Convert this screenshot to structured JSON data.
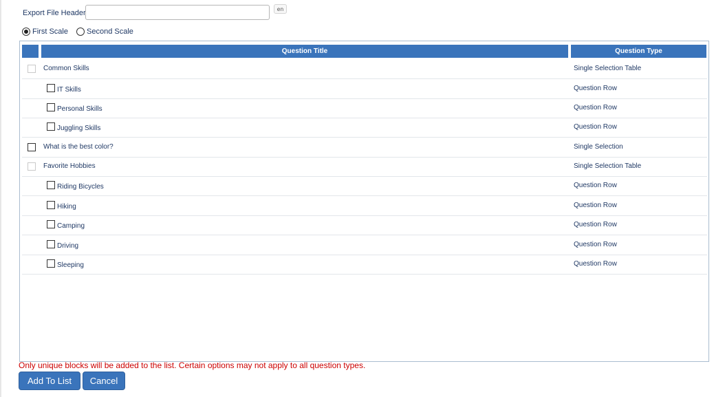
{
  "export_header": {
    "label": "Export File Header",
    "value": "",
    "placeholder": "",
    "lang": "en"
  },
  "scale": {
    "options": [
      {
        "label": "First Scale",
        "selected": true
      },
      {
        "label": "Second Scale",
        "selected": false
      }
    ]
  },
  "table": {
    "columns": [
      "Question Title",
      "Question Type"
    ],
    "rows": [
      {
        "title": "Common Skills",
        "type": "Single Selection Table",
        "level": 0,
        "disabled": true
      },
      {
        "title": "IT Skills",
        "type": "Question Row",
        "level": 1,
        "disabled": false
      },
      {
        "title": "Personal Skills",
        "type": "Question Row",
        "level": 1,
        "disabled": false
      },
      {
        "title": "Juggling Skills",
        "type": "Question Row",
        "level": 1,
        "disabled": false
      },
      {
        "title": "What is the best color?",
        "type": "Single Selection",
        "level": 0,
        "disabled": false
      },
      {
        "title": "Favorite Hobbies",
        "type": "Single Selection Table",
        "level": 0,
        "disabled": true
      },
      {
        "title": "Riding Bicycles",
        "type": "Question Row",
        "level": 1,
        "disabled": false
      },
      {
        "title": "Hiking",
        "type": "Question Row",
        "level": 1,
        "disabled": false
      },
      {
        "title": "Camping",
        "type": "Question Row",
        "level": 1,
        "disabled": false
      },
      {
        "title": "Driving",
        "type": "Question Row",
        "level": 1,
        "disabled": false
      },
      {
        "title": "Sleeping",
        "type": "Question Row",
        "level": 1,
        "disabled": false
      }
    ]
  },
  "notice": "Only unique blocks will be added to the list. Certain options may not apply to all question types.",
  "buttons": {
    "add": "Add To List",
    "cancel": "Cancel"
  },
  "colors": {
    "header_blue": "#3a74bb",
    "notice_red": "#cc0000",
    "text_navy": "#1f3864"
  }
}
